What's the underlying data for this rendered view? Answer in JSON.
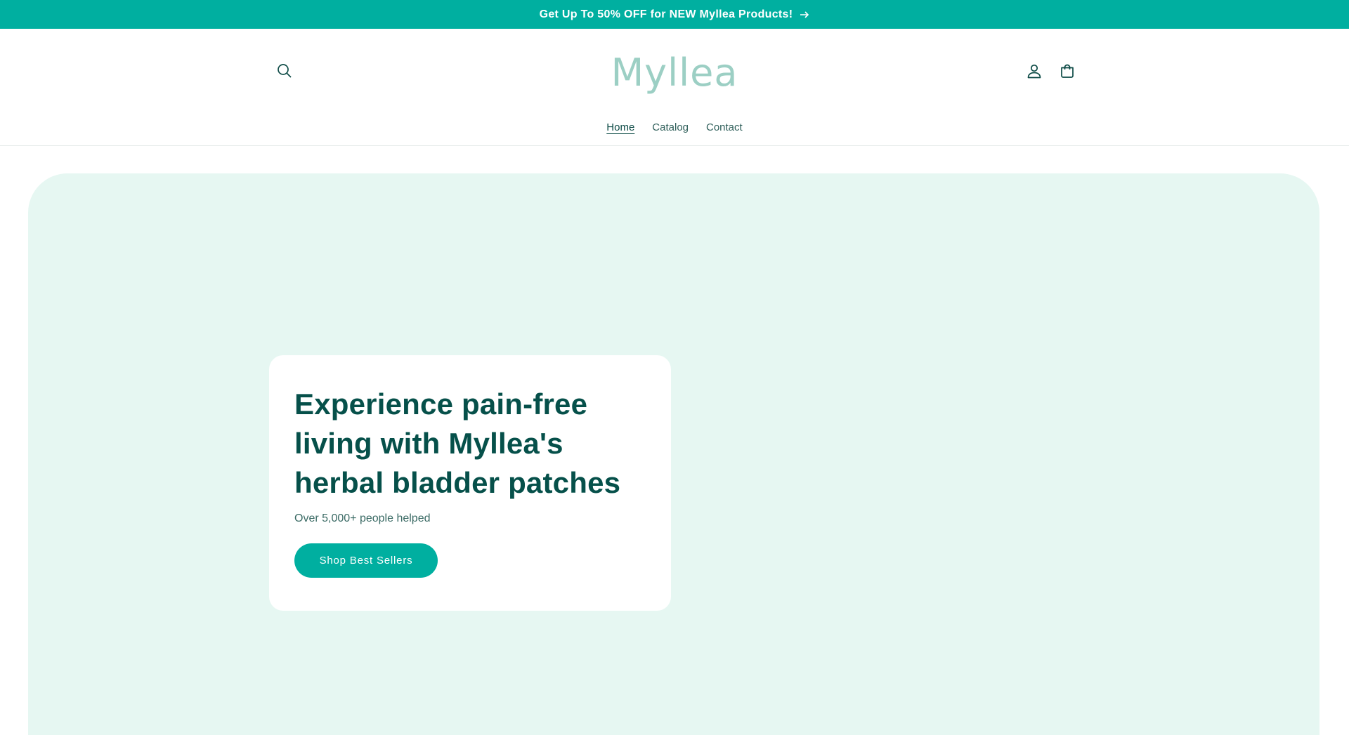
{
  "announcement": {
    "text": "Get Up To 50% OFF for NEW Myllea Products!",
    "icon": "arrow-right-icon"
  },
  "header": {
    "logo_text": "Myllea",
    "icons": [
      "search-icon",
      "account-icon",
      "cart-icon"
    ],
    "nav": {
      "home": "Home",
      "catalog": "Catalog",
      "contact": "Contact",
      "active": "Home"
    }
  },
  "hero": {
    "title": "Experience pain-free living with Myllea's herbal bladder patches",
    "subtitle": "Over 5,000+ people helped",
    "cta_label": "Shop Best Sellers"
  },
  "colors": {
    "accent": "#00afa0",
    "heading": "#06504a",
    "hero_background": "#e6f7f2",
    "logo": "#9ccfc4"
  }
}
